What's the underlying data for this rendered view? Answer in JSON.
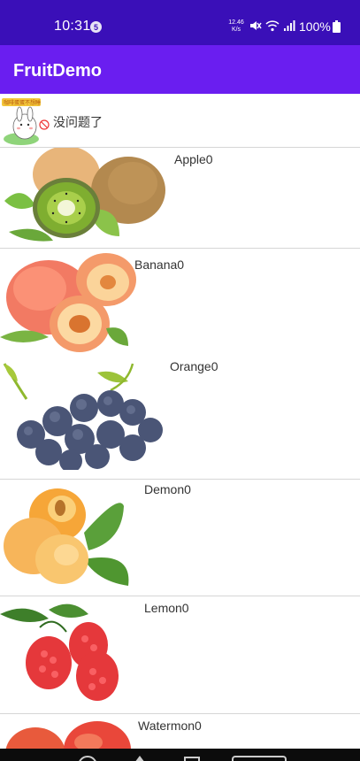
{
  "status_bar": {
    "time": "10:31",
    "notification_badge": "5",
    "net_speed_value": "12.46",
    "net_speed_unit": "K/s",
    "battery": "100%",
    "icons": [
      "mute-icon",
      "wifi-icon",
      "signal-icon",
      "battery-icon"
    ]
  },
  "app_bar": {
    "title": "FruitDemo"
  },
  "header": {
    "text": "没问题了",
    "sticker_caption": "咖啡蛋蛋不想睡"
  },
  "fruits": [
    {
      "name": "Apple0"
    },
    {
      "name": "Banana0"
    },
    {
      "name": "Orange0"
    },
    {
      "name": "Demon0"
    },
    {
      "name": "Lemon0"
    },
    {
      "name": "Watermon0"
    }
  ],
  "colors": {
    "status_bar": "#3a0fb8",
    "app_bar": "#6a1ef0",
    "list_background": "#fafafa",
    "divider": "#d6d6d6"
  }
}
